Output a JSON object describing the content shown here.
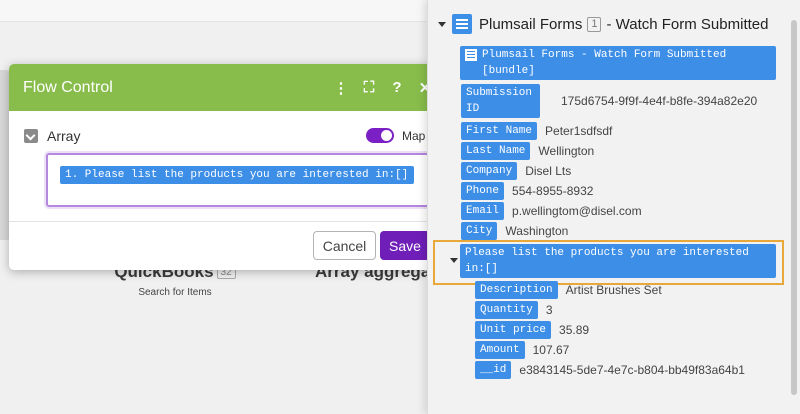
{
  "background": {
    "module1": {
      "name": "QuickBooks",
      "badge": "32",
      "subtitle": "Search for Items"
    },
    "module2": {
      "name": "Array aggrega"
    }
  },
  "dialog": {
    "title": "Flow Control",
    "tools": {
      "more": "⋮",
      "expand": "⛶",
      "help": "?",
      "close": "✕"
    },
    "field_label": "Array",
    "map_label": "Map",
    "map_on": true,
    "field_value": "1. Please list the products you are interested in:[]",
    "cancel_label": "Cancel",
    "save_label": "Save"
  },
  "panel": {
    "header": {
      "title": "Plumsail Forms",
      "badge": "1",
      "subtitle": "- Watch Form Submitted"
    },
    "bundle": "Plumsail Forms - Watch Form Submitted [bundle]",
    "fields": [
      {
        "key": "Submission ID",
        "value": "175d6754-9f9f-4e4f-b8fe-394a82e20"
      },
      {
        "key": "First Name",
        "value": "Peter1sdfsdf"
      },
      {
        "key": "Last Name",
        "value": "Wellington"
      },
      {
        "key": "Company",
        "value": "Disel Lts"
      },
      {
        "key": "Phone",
        "value": "554-8955-8932"
      },
      {
        "key": "Email",
        "value": "p.wellingtom@disel.com"
      },
      {
        "key": "City",
        "value": "Washington"
      }
    ],
    "array_item": "Please list the products you are interested in:[]",
    "array_fields": [
      {
        "key": "Description",
        "value": "Artist Brushes Set"
      },
      {
        "key": "Quantity",
        "value": "3"
      },
      {
        "key": "Unit price",
        "value": "35.89"
      },
      {
        "key": "Amount",
        "value": "107.67"
      },
      {
        "key": "__id",
        "value": "e3843145-5de7-4e7c-b804-bb49f83a64b1"
      }
    ]
  },
  "colors": {
    "accent_purple": "#6f1eb8",
    "header_green": "#88bd4b",
    "pill_blue": "#3d8ee7",
    "highlight_orange": "#e8a93a"
  }
}
